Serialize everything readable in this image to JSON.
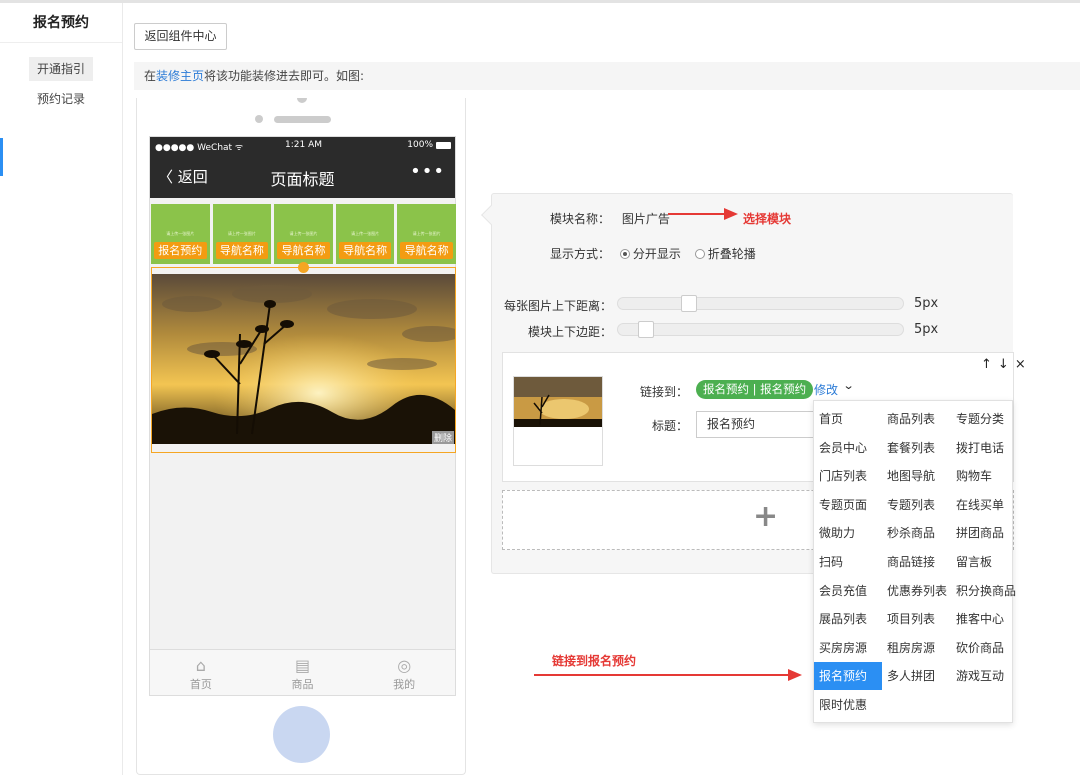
{
  "sidebar": {
    "title": "报名预约",
    "items": [
      {
        "label": "开通指引"
      },
      {
        "label": "预约记录"
      }
    ]
  },
  "toolbar": {
    "back_label": "返回组件中心"
  },
  "hint": {
    "prefix": "在",
    "link": "装修主页",
    "suffix": "将该功能装修进去即可。如图:"
  },
  "phone": {
    "status": {
      "carrier": "●●●●● WeChat ᯤ",
      "time": "1:21 AM",
      "battery": "100%"
    },
    "nav": {
      "back": "〈 返回",
      "title": "页面标题",
      "more": "•••"
    },
    "nav_items": [
      {
        "label": "报名预约",
        "tiny": "请上传一张图片"
      },
      {
        "label": "导航名称",
        "tiny": "请上传一张图片"
      },
      {
        "label": "导航名称",
        "tiny": "请上传一张图片"
      },
      {
        "label": "导航名称",
        "tiny": "请上传一张图片"
      },
      {
        "label": "导航名称",
        "tiny": "请上传一张图片"
      }
    ],
    "delete_tag": "删除",
    "tabs": [
      {
        "label": "首页"
      },
      {
        "label": "商品"
      },
      {
        "label": "我的"
      }
    ]
  },
  "editor": {
    "module_name_label": "模块名称：",
    "module_name_value": "图片广告",
    "display_label": "显示方式：",
    "display_options": [
      {
        "label": "分开显示",
        "selected": true
      },
      {
        "label": "折叠轮播",
        "selected": false
      }
    ],
    "spacing_label": "每张图片上下距离：",
    "spacing_value": "5px",
    "margin_label": "模块上下边距：",
    "margin_value": "5px",
    "link_label": "链接到：",
    "link_value": "报名预约 | 报名预约",
    "edit_link": "修改",
    "title_label": "标题：",
    "title_value": "报名预约"
  },
  "dropdown": {
    "items": [
      "首页",
      "商品列表",
      "专题分类",
      "会员中心",
      "套餐列表",
      "拨打电话",
      "门店列表",
      "地图导航",
      "购物车",
      "专题页面",
      "专题列表",
      "在线买单",
      "微助力",
      "秒杀商品",
      "拼团商品",
      "扫码",
      "商品链接",
      "留言板",
      "会员充值",
      "优惠券列表",
      "积分换商品",
      "展品列表",
      "项目列表",
      "推客中心",
      "买房房源",
      "租房房源",
      "砍价商品",
      "报名预约",
      "多人拼团",
      "游戏互动",
      "限时优惠"
    ],
    "selected": "报名预约"
  },
  "annotations": {
    "select_module": "选择模块",
    "link_to": "链接到报名预约"
  },
  "colors": {
    "accent": "#2b8ff3",
    "nav_green": "#8bc34a",
    "nav_orange": "#f39c12",
    "annotation": "#e53935"
  }
}
